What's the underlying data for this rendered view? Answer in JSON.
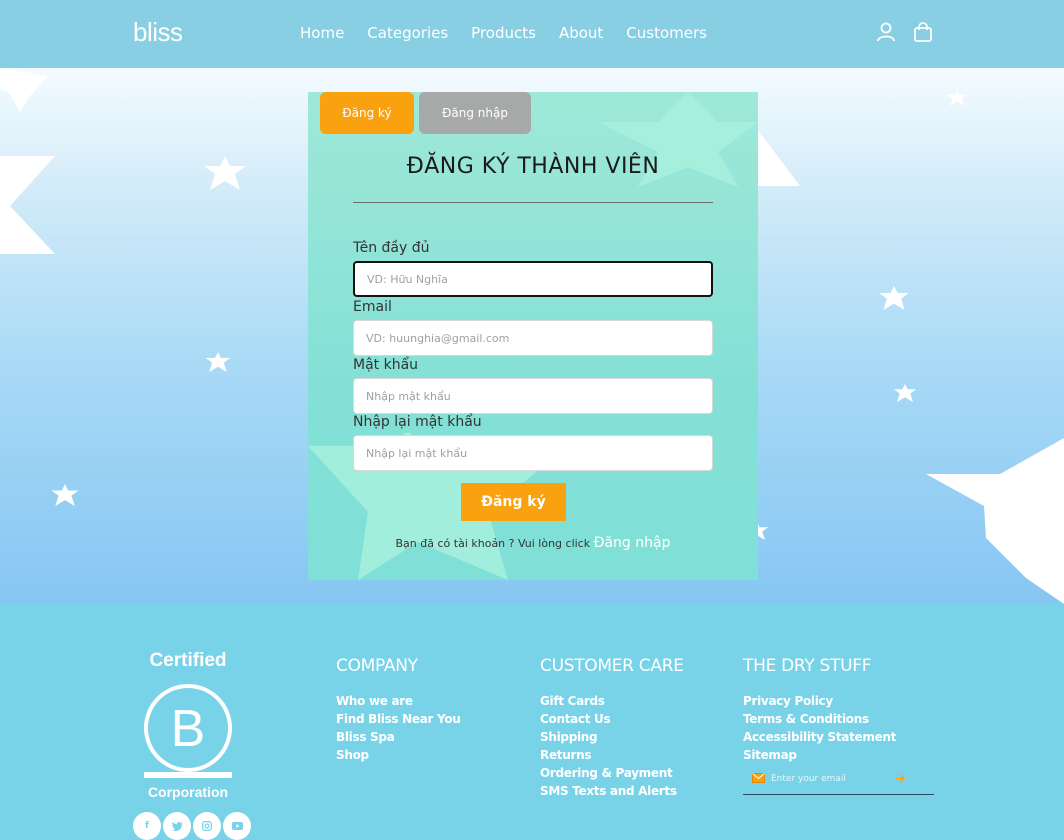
{
  "header": {
    "logo": "bliss",
    "nav": [
      "Home",
      "Categories",
      "Products",
      "About",
      "Customers"
    ],
    "icons": [
      "user-icon",
      "shopping-bag-icon"
    ]
  },
  "form": {
    "tab_register": "Đăng ký",
    "tab_login": "Đăng nhập",
    "title": "ĐĂNG KÝ THÀNH VIÊN",
    "fields": [
      {
        "label": "Tên đầy đủ",
        "placeholder": "VD: Hữu Nghĩa",
        "value": ""
      },
      {
        "label": "Email",
        "placeholder": "VD: huunghia@gmail.com",
        "value": ""
      },
      {
        "label": "Mật khẩu",
        "placeholder": "Nhập mật khẩu",
        "value": ""
      },
      {
        "label": "Nhập lại mật khẩu",
        "placeholder": "Nhập lại mật khẩu",
        "value": ""
      }
    ],
    "submit": "Đăng ký",
    "login_prompt": "Bạn đã có tài khoản ? Vui lòng click",
    "login_link": "Đăng nhập"
  },
  "footer": {
    "bcorp_top": "Certified",
    "bcorp_letter": "B",
    "bcorp_bottom": "Corporation",
    "columns": [
      {
        "title": "COMPANY",
        "links": [
          "Who we are",
          "Find Bliss Near You",
          "Bliss Spa",
          "Shop"
        ]
      },
      {
        "title": "CUSTOMER CARE",
        "links": [
          "Gift Cards",
          "Contact Us",
          "Shipping",
          "Returns",
          "Ordering & Payment",
          "SMS Texts and Alerts"
        ]
      },
      {
        "title": "THE DRY STUFF",
        "links": [
          "Privacy Policy",
          "Terms & Conditions",
          "Accessibility Statement",
          "Sitemap"
        ]
      }
    ],
    "email_placeholder": "Enter your email",
    "socials": [
      "facebook-icon",
      "twitter-icon",
      "instagram-icon",
      "youtube-icon"
    ]
  },
  "colors": {
    "accent": "#f9a10e",
    "header_bg": "#89cfe3",
    "footer_bg": "#79d3e8",
    "card_bg": "#84e0d6"
  }
}
